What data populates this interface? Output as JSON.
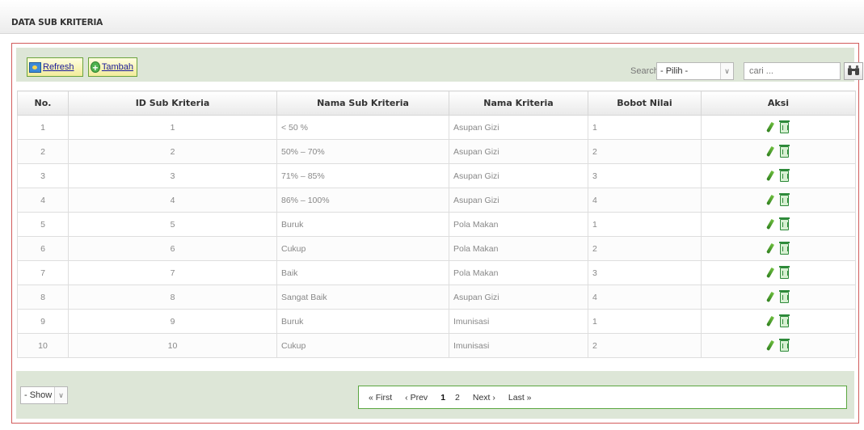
{
  "page_title": "DATA SUB KRITERIA",
  "toolbar": {
    "refresh_label": "Refresh",
    "add_label": "Tambah",
    "search_label": "Search",
    "filter_selected": "- Pilih -",
    "search_placeholder": "cari ..."
  },
  "table": {
    "columns": [
      "No.",
      "ID Sub Kriteria",
      "Nama Sub Kriteria",
      "Nama Kriteria",
      "Bobot Nilai",
      "Aksi"
    ],
    "rows": [
      [
        "1",
        "1",
        "< 50 %",
        "Asupan Gizi",
        "1"
      ],
      [
        "2",
        "2",
        "50% – 70%",
        "Asupan Gizi",
        "2"
      ],
      [
        "3",
        "3",
        "71% – 85%",
        "Asupan Gizi",
        "3"
      ],
      [
        "4",
        "4",
        "86% – 100%",
        "Asupan Gizi",
        "4"
      ],
      [
        "5",
        "5",
        "Buruk",
        "Pola Makan",
        "1"
      ],
      [
        "6",
        "6",
        "Cukup",
        "Pola Makan",
        "2"
      ],
      [
        "7",
        "7",
        "Baik",
        "Pola Makan",
        "3"
      ],
      [
        "8",
        "8",
        "Sangat Baik",
        "Asupan Gizi",
        "4"
      ],
      [
        "9",
        "9",
        "Buruk",
        "Imunisasi",
        "1"
      ],
      [
        "10",
        "10",
        "Cukup",
        "Imunisasi",
        "2"
      ]
    ]
  },
  "footer": {
    "show_selected": "- Show -",
    "pager": {
      "first": "« First",
      "prev": "‹ Prev",
      "pages": [
        "1",
        "2"
      ],
      "current": "1",
      "next": "Next ›",
      "last": "Last »"
    }
  },
  "icons": {
    "refresh": "refresh-icon",
    "add": "add-icon",
    "search": "binoculars-icon",
    "edit": "edit-pencil-icon",
    "delete": "trash-icon"
  },
  "colors": {
    "panel_border": "#d25b5b",
    "toolbar_bg": "#dde6d7",
    "button_border": "#6aa33e",
    "pager_border": "#5aa640"
  }
}
